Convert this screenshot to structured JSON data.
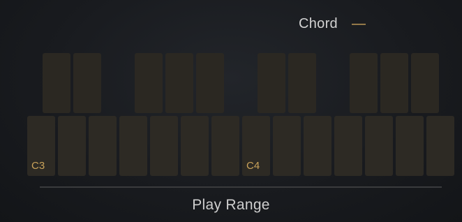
{
  "chord": {
    "label": "Chord",
    "value": "—"
  },
  "keyboard": {
    "white_keys": [
      "C3",
      "",
      "",
      "",
      "",
      "",
      "",
      "C4",
      "",
      "",
      "",
      "",
      "",
      "",
      ""
    ],
    "black_key_count": 10
  },
  "play_range": {
    "label": "Play Range"
  }
}
